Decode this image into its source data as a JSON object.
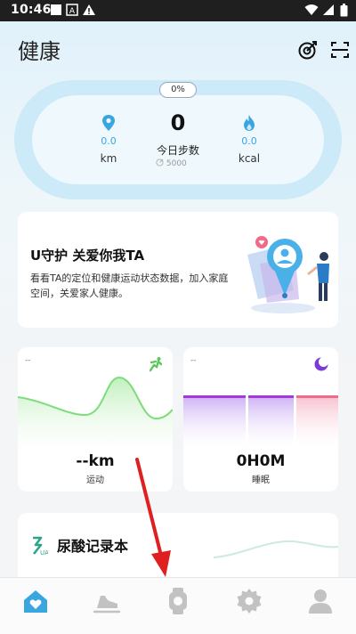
{
  "status_bar": {
    "time": "10:46",
    "left_icons": [
      "image-icon",
      "notification-icon",
      "warning-icon"
    ],
    "right_icons": [
      "wifi-icon",
      "signal-icon",
      "battery-icon"
    ]
  },
  "header": {
    "title": "健康",
    "actions": [
      "target-icon",
      "scan-icon"
    ]
  },
  "summary": {
    "progress_percent_text": "0%",
    "distance": {
      "value": "0.0",
      "unit": "km",
      "icon": "location-pin-icon"
    },
    "steps": {
      "value": "0",
      "label": "今日步数",
      "goal": "5000"
    },
    "calories": {
      "value": "0.0",
      "unit": "kcal",
      "icon": "flame-icon"
    }
  },
  "guard_card": {
    "title": "U守护 关爱你我TA",
    "description": "看看TA的定位和健康运动状态数据，加入家庭空间，关爱家人健康。"
  },
  "exercise_card": {
    "dash": "--",
    "value": "--km",
    "label": "运动",
    "icon": "running-icon"
  },
  "sleep_card": {
    "dash": "--",
    "value": "0H0M",
    "label": "睡眠",
    "icon": "moon-icon"
  },
  "uric_card": {
    "title": "尿酸记录本",
    "icon": "uric-acid-icon"
  },
  "bottom_nav": [
    {
      "name": "home",
      "icon": "home-heart-icon",
      "active": true
    },
    {
      "name": "sport",
      "icon": "shoe-icon",
      "active": false
    },
    {
      "name": "device",
      "icon": "watch-icon",
      "active": false
    },
    {
      "name": "settings",
      "icon": "gear-icon",
      "active": false
    },
    {
      "name": "profile",
      "icon": "person-icon",
      "active": false
    }
  ],
  "colors": {
    "accent": "#3aa6e0",
    "exercise_green": "#7fdc7a",
    "sleep_purple": "#a23ad8",
    "sleep_pink": "#f06a8a",
    "annotation_red": "#e02020"
  }
}
